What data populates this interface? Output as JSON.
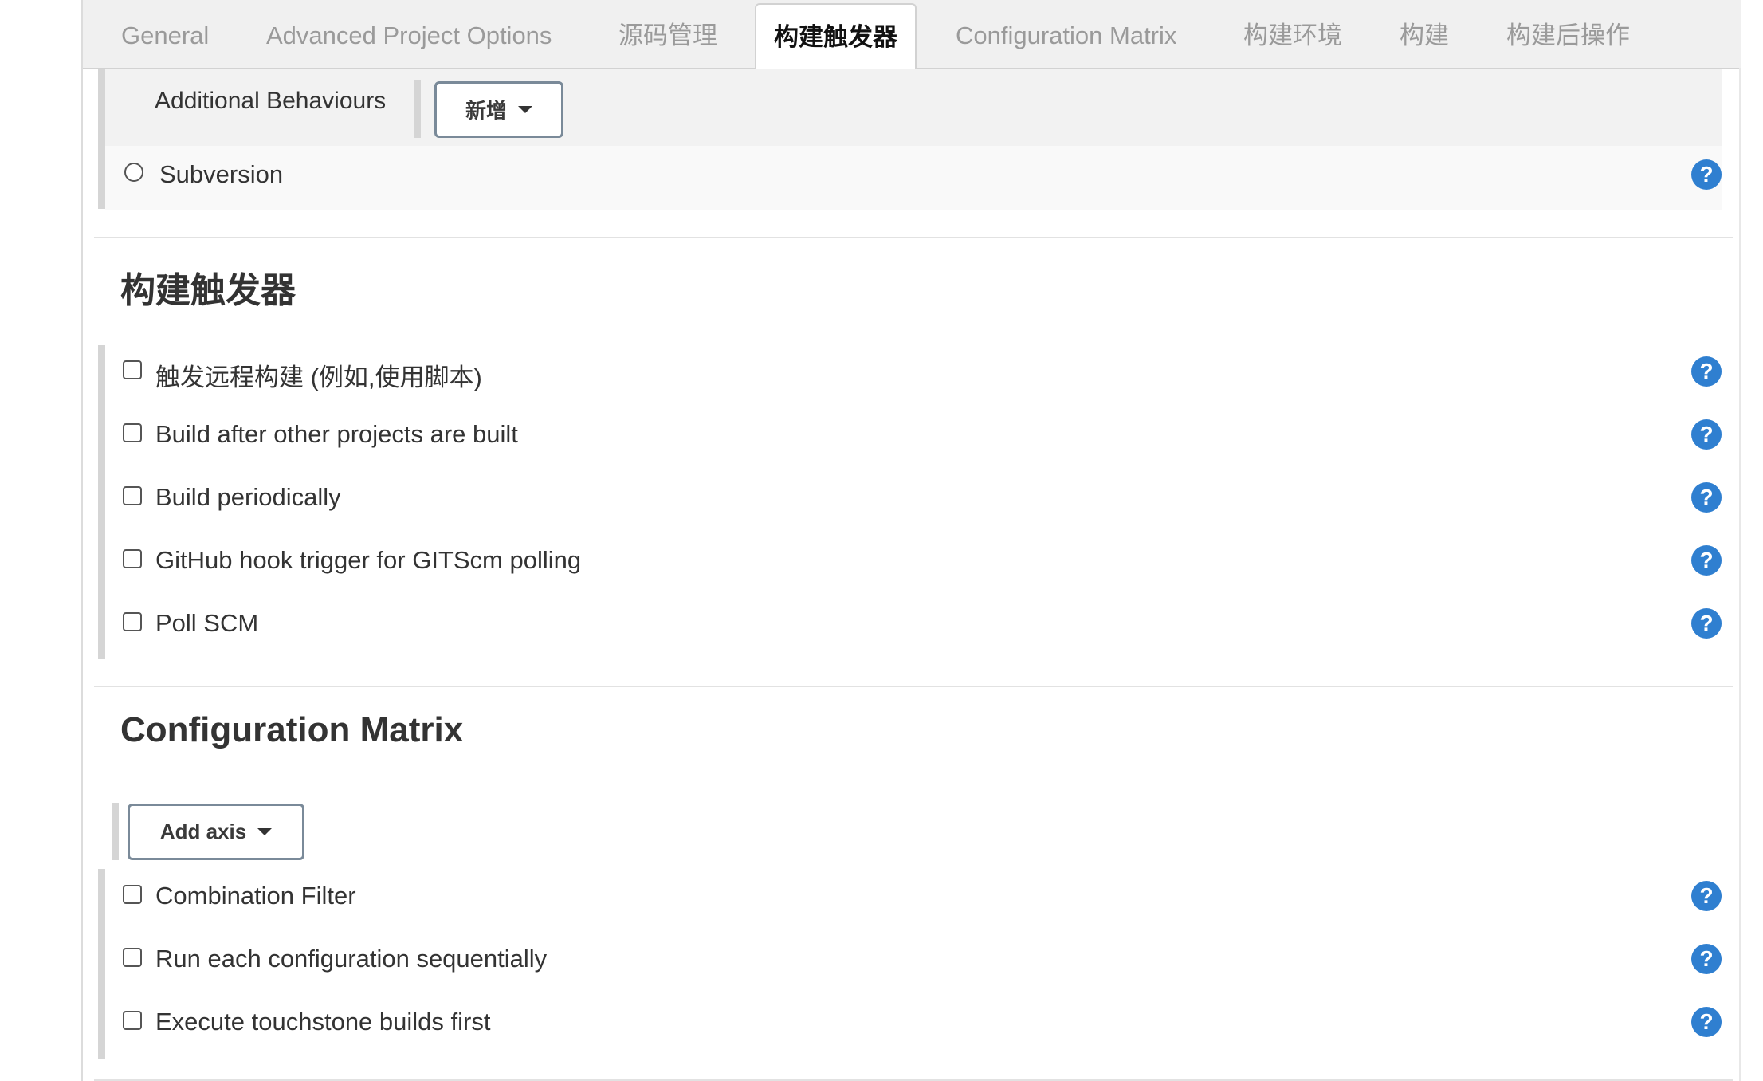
{
  "tabs": [
    {
      "label": "General",
      "active": false
    },
    {
      "label": "Advanced Project Options",
      "active": false
    },
    {
      "label": "源码管理",
      "active": false
    },
    {
      "label": "构建触发器",
      "active": true
    },
    {
      "label": "Configuration Matrix",
      "active": false
    },
    {
      "label": "构建环境",
      "active": false
    },
    {
      "label": "构建",
      "active": false
    },
    {
      "label": "构建后操作",
      "active": false
    }
  ],
  "scm": {
    "additional_behaviours_label": "Additional Behaviours",
    "add_button_label": "新增",
    "subversion_label": "Subversion",
    "subversion_selected": false
  },
  "triggers": {
    "title": "构建触发器",
    "options": [
      {
        "label": "触发远程构建 (例如,使用脚本)",
        "checked": false
      },
      {
        "label": "Build after other projects are built",
        "checked": false
      },
      {
        "label": "Build periodically",
        "checked": false
      },
      {
        "label": "GitHub hook trigger for GITScm polling",
        "checked": false
      },
      {
        "label": "Poll SCM",
        "checked": false
      }
    ]
  },
  "matrix": {
    "title": "Configuration Matrix",
    "add_axis_label": "Add axis",
    "options": [
      {
        "label": "Combination Filter",
        "checked": false
      },
      {
        "label": "Run each configuration sequentially",
        "checked": false
      },
      {
        "label": "Execute touchstone builds first",
        "checked": false
      }
    ]
  },
  "help_icon_glyph": "?",
  "colors": {
    "help_icon": "#2f7fd0",
    "tab_bar": "#f0f0f0",
    "section_bar": "#d5d5d5"
  }
}
